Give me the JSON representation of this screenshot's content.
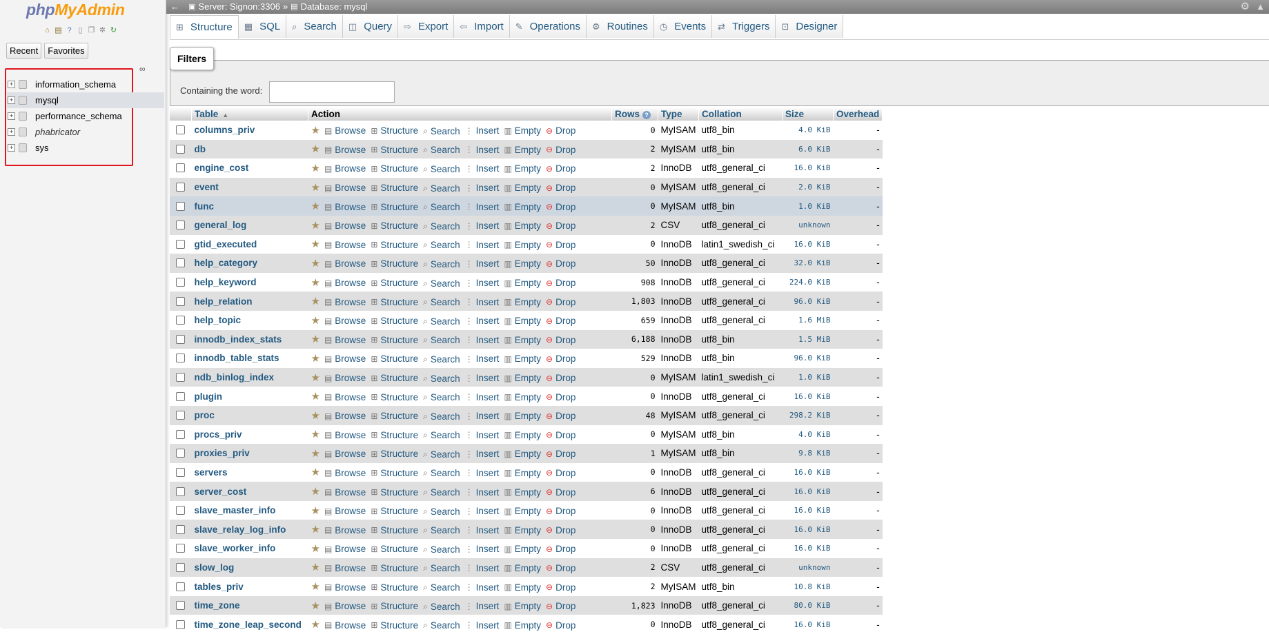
{
  "nav": {
    "logo_php": "php",
    "logo_myadmin": "MyAdmin",
    "tab_recent": "Recent",
    "tab_favorites": "Favorites",
    "databases": [
      {
        "name": "information_schema",
        "italic": false
      },
      {
        "name": "mysql",
        "italic": false
      },
      {
        "name": "performance_schema",
        "italic": false
      },
      {
        "name": "phabricator",
        "italic": true
      },
      {
        "name": "sys",
        "italic": false
      }
    ]
  },
  "topbar": {
    "server": "Server: Signon:3306",
    "sep": "»",
    "database": "Database: mysql"
  },
  "menu": {
    "tabs": [
      {
        "label": "Structure",
        "icon": "structure-icon"
      },
      {
        "label": "SQL",
        "icon": "sql-icon"
      },
      {
        "label": "Search",
        "icon": "search-icon"
      },
      {
        "label": "Query",
        "icon": "query-icon"
      },
      {
        "label": "Export",
        "icon": "export-icon"
      },
      {
        "label": "Import",
        "icon": "import-icon"
      },
      {
        "label": "Operations",
        "icon": "wrench-icon"
      },
      {
        "label": "Routines",
        "icon": "routines-icon"
      },
      {
        "label": "Events",
        "icon": "clock-icon"
      },
      {
        "label": "Triggers",
        "icon": "triggers-icon"
      },
      {
        "label": "Designer",
        "icon": "designer-icon"
      }
    ]
  },
  "filters": {
    "legend": "Filters",
    "label": "Containing the word:",
    "value": ""
  },
  "table": {
    "headers": {
      "table": "Table",
      "action": "Action",
      "rows": "Rows",
      "type": "Type",
      "collation": "Collation",
      "size": "Size",
      "overhead": "Overhead"
    },
    "actions": {
      "browse": "Browse",
      "structure": "Structure",
      "search": "Search",
      "insert": "Insert",
      "empty": "Empty",
      "drop": "Drop"
    },
    "rows": [
      {
        "name": "columns_priv",
        "rows": "0",
        "type": "MyISAM",
        "collation": "utf8_bin",
        "size": "4.0 KiB",
        "overhead": "-"
      },
      {
        "name": "db",
        "rows": "2",
        "type": "MyISAM",
        "collation": "utf8_bin",
        "size": "6.0 KiB",
        "overhead": "-"
      },
      {
        "name": "engine_cost",
        "rows": "2",
        "type": "InnoDB",
        "collation": "utf8_general_ci",
        "size": "16.0 KiB",
        "overhead": "-"
      },
      {
        "name": "event",
        "rows": "0",
        "type": "MyISAM",
        "collation": "utf8_general_ci",
        "size": "2.0 KiB",
        "overhead": "-"
      },
      {
        "name": "func",
        "rows": "0",
        "type": "MyISAM",
        "collation": "utf8_bin",
        "size": "1.0 KiB",
        "overhead": "-"
      },
      {
        "name": "general_log",
        "rows": "2",
        "type": "CSV",
        "collation": "utf8_general_ci",
        "size": "unknown",
        "overhead": "-"
      },
      {
        "name": "gtid_executed",
        "rows": "0",
        "type": "InnoDB",
        "collation": "latin1_swedish_ci",
        "size": "16.0 KiB",
        "overhead": "-"
      },
      {
        "name": "help_category",
        "rows": "50",
        "type": "InnoDB",
        "collation": "utf8_general_ci",
        "size": "32.0 KiB",
        "overhead": "-"
      },
      {
        "name": "help_keyword",
        "rows": "908",
        "type": "InnoDB",
        "collation": "utf8_general_ci",
        "size": "224.0 KiB",
        "overhead": "-"
      },
      {
        "name": "help_relation",
        "rows": "1,803",
        "type": "InnoDB",
        "collation": "utf8_general_ci",
        "size": "96.0 KiB",
        "overhead": "-"
      },
      {
        "name": "help_topic",
        "rows": "659",
        "type": "InnoDB",
        "collation": "utf8_general_ci",
        "size": "1.6 MiB",
        "overhead": "-"
      },
      {
        "name": "innodb_index_stats",
        "rows": "6,188",
        "type": "InnoDB",
        "collation": "utf8_bin",
        "size": "1.5 MiB",
        "overhead": "-"
      },
      {
        "name": "innodb_table_stats",
        "rows": "529",
        "type": "InnoDB",
        "collation": "utf8_bin",
        "size": "96.0 KiB",
        "overhead": "-"
      },
      {
        "name": "ndb_binlog_index",
        "rows": "0",
        "type": "MyISAM",
        "collation": "latin1_swedish_ci",
        "size": "1.0 KiB",
        "overhead": "-"
      },
      {
        "name": "plugin",
        "rows": "0",
        "type": "InnoDB",
        "collation": "utf8_general_ci",
        "size": "16.0 KiB",
        "overhead": "-"
      },
      {
        "name": "proc",
        "rows": "48",
        "type": "MyISAM",
        "collation": "utf8_general_ci",
        "size": "298.2 KiB",
        "overhead": "-"
      },
      {
        "name": "procs_priv",
        "rows": "0",
        "type": "MyISAM",
        "collation": "utf8_bin",
        "size": "4.0 KiB",
        "overhead": "-"
      },
      {
        "name": "proxies_priv",
        "rows": "1",
        "type": "MyISAM",
        "collation": "utf8_bin",
        "size": "9.8 KiB",
        "overhead": "-"
      },
      {
        "name": "servers",
        "rows": "0",
        "type": "InnoDB",
        "collation": "utf8_general_ci",
        "size": "16.0 KiB",
        "overhead": "-"
      },
      {
        "name": "server_cost",
        "rows": "6",
        "type": "InnoDB",
        "collation": "utf8_general_ci",
        "size": "16.0 KiB",
        "overhead": "-"
      },
      {
        "name": "slave_master_info",
        "rows": "0",
        "type": "InnoDB",
        "collation": "utf8_general_ci",
        "size": "16.0 KiB",
        "overhead": "-"
      },
      {
        "name": "slave_relay_log_info",
        "rows": "0",
        "type": "InnoDB",
        "collation": "utf8_general_ci",
        "size": "16.0 KiB",
        "overhead": "-"
      },
      {
        "name": "slave_worker_info",
        "rows": "0",
        "type": "InnoDB",
        "collation": "utf8_general_ci",
        "size": "16.0 KiB",
        "overhead": "-"
      },
      {
        "name": "slow_log",
        "rows": "2",
        "type": "CSV",
        "collation": "utf8_general_ci",
        "size": "unknown",
        "overhead": "-"
      },
      {
        "name": "tables_priv",
        "rows": "2",
        "type": "MyISAM",
        "collation": "utf8_bin",
        "size": "10.8 KiB",
        "overhead": "-"
      },
      {
        "name": "time_zone",
        "rows": "1,823",
        "type": "InnoDB",
        "collation": "utf8_general_ci",
        "size": "80.0 KiB",
        "overhead": "-"
      },
      {
        "name": "time_zone_leap_second",
        "rows": "0",
        "type": "InnoDB",
        "collation": "utf8_general_ci",
        "size": "16.0 KiB",
        "overhead": "-"
      }
    ]
  }
}
